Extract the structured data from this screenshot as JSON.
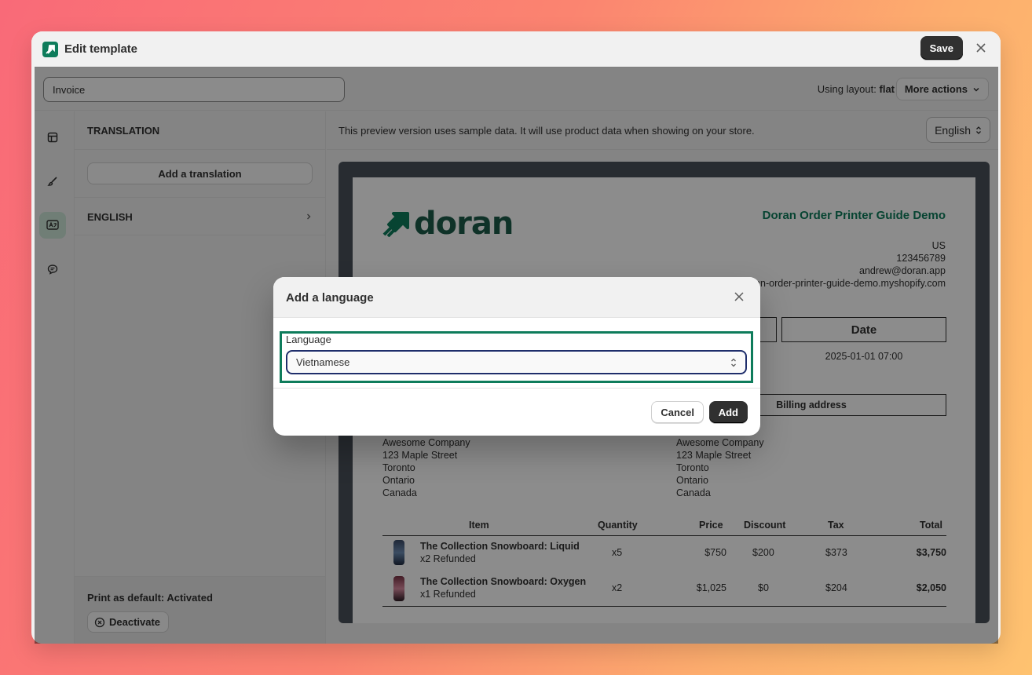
{
  "window": {
    "title": "Edit template",
    "save_label": "Save",
    "brand_color": "#0e7c5b"
  },
  "topbar": {
    "template_name": "Invoice",
    "layout_prefix": "Using layout:",
    "layout_value": "flat",
    "more_actions_label": "More actions"
  },
  "rail": {
    "items": [
      {
        "icon": "layout-icon",
        "active": false
      },
      {
        "icon": "brush-icon",
        "active": false
      },
      {
        "icon": "translate-icon",
        "active": true
      },
      {
        "icon": "chat-icon",
        "active": false
      }
    ]
  },
  "panel": {
    "heading": "TRANSLATION",
    "add_translation_label": "Add a translation",
    "languages": [
      {
        "label": "ENGLISH"
      }
    ],
    "default_status": "Print as default: Activated",
    "deactivate_label": "Deactivate"
  },
  "preview": {
    "note": "This preview version uses sample data. It will use product data when showing on your store.",
    "language": "English",
    "doc": {
      "logo_word": "doran",
      "shop_name": "Doran Order Printer Guide Demo",
      "shop_address": [
        "US",
        "123456789",
        "andrew@doran.app",
        "doran-order-printer-guide-demo.myshopify.com"
      ],
      "date_header": "Date",
      "date_value": "2025-01-01 07:00",
      "billing_header": "Billing address",
      "shipping_lines": [
        "Awesome Company",
        "123 Maple Street",
        "Toronto",
        "Ontario",
        "Canada"
      ],
      "billing_lines": [
        "Awesome Company",
        "123 Maple Street",
        "Toronto",
        "Ontario",
        "Canada"
      ],
      "columns": [
        "Item",
        "Quantity",
        "Price",
        "Discount",
        "Tax",
        "Total"
      ],
      "rows": [
        {
          "name": "The Collection Snowboard: Liquid",
          "note": "x2 Refunded",
          "qty": "x5",
          "price": "$750",
          "discount": "$200",
          "tax": "$373",
          "total": "$3,750"
        },
        {
          "name": "The Collection Snowboard: Oxygen",
          "note": "x1 Refunded",
          "qty": "x2",
          "price": "$1,025",
          "discount": "$0",
          "tax": "$204",
          "total": "$2,050"
        }
      ]
    }
  },
  "modal": {
    "title": "Add a language",
    "field_label": "Language",
    "selected_language": "Vietnamese",
    "cancel_label": "Cancel",
    "add_label": "Add"
  }
}
